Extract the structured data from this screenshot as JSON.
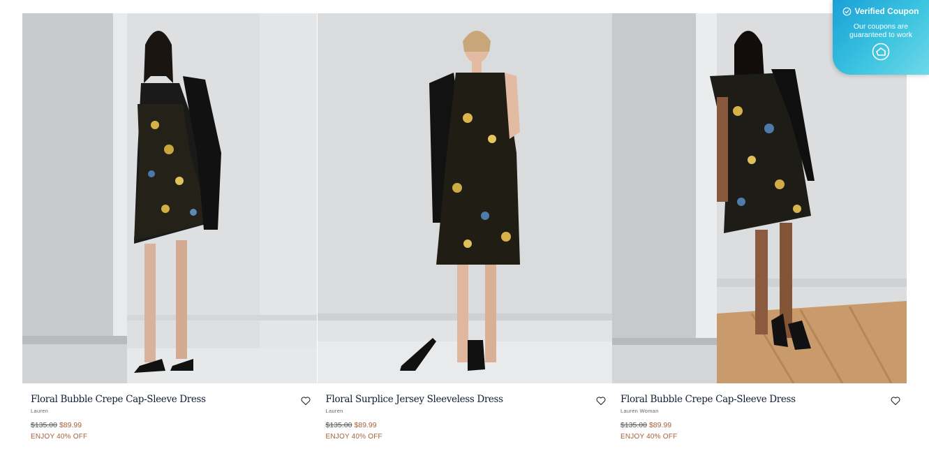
{
  "products": [
    {
      "title": "Floral Bubble Crepe Cap-Sleeve Dress",
      "brand": "Lauren",
      "original_price": "$135.00",
      "sale_price": "$89.99",
      "promo": "ENJOY 40% OFF"
    },
    {
      "title": "Floral Surplice Jersey Sleeveless Dress",
      "brand": "Lauren",
      "original_price": "$135.00",
      "sale_price": "$89.99",
      "promo": "ENJOY 40% OFF"
    },
    {
      "title": "Floral Bubble Crepe Cap-Sleeve Dress",
      "brand": "Lauren Woman",
      "original_price": "$135.00",
      "sale_price": "$89.99",
      "promo": "ENJOY 40% OFF"
    }
  ],
  "coupon_badge": {
    "title": "Verified Coupon",
    "subtitle": "Our coupons are guaranteed to work",
    "icon": "check-circle-icon",
    "logo_icon": "coupon-logo-icon"
  },
  "colors": {
    "title": "#141c33",
    "sale": "#a7603a",
    "badge": "#2bb3dc"
  }
}
